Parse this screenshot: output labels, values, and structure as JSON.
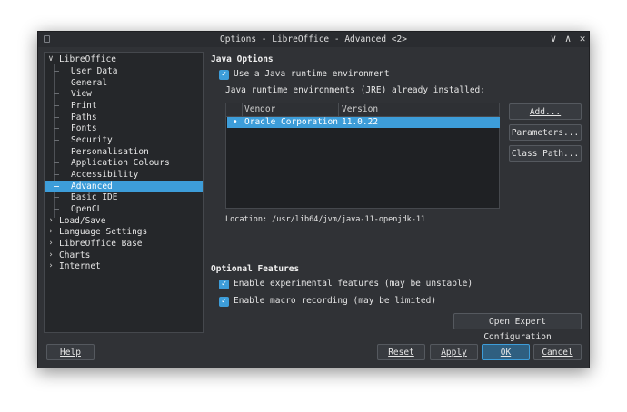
{
  "window": {
    "title": "Options - LibreOffice - Advanced <2>"
  },
  "titlebar_buttons": {
    "minimize": "∨",
    "maximize": "∧",
    "close": "✕"
  },
  "tree": {
    "items": [
      {
        "label": "LibreOffice",
        "level": 0,
        "expanded": true
      },
      {
        "label": "User Data",
        "level": 1
      },
      {
        "label": "General",
        "level": 1
      },
      {
        "label": "View",
        "level": 1
      },
      {
        "label": "Print",
        "level": 1
      },
      {
        "label": "Paths",
        "level": 1
      },
      {
        "label": "Fonts",
        "level": 1
      },
      {
        "label": "Security",
        "level": 1
      },
      {
        "label": "Personalisation",
        "level": 1
      },
      {
        "label": "Application Colours",
        "level": 1
      },
      {
        "label": "Accessibility",
        "level": 1
      },
      {
        "label": "Advanced",
        "level": 1,
        "selected": true
      },
      {
        "label": "Basic IDE",
        "level": 1
      },
      {
        "label": "OpenCL",
        "level": 1
      },
      {
        "label": "Load/Save",
        "level": 0,
        "expanded": false
      },
      {
        "label": "Language Settings",
        "level": 0,
        "expanded": false
      },
      {
        "label": "LibreOffice Base",
        "level": 0,
        "expanded": false
      },
      {
        "label": "Charts",
        "level": 0,
        "expanded": false
      },
      {
        "label": "Internet",
        "level": 0,
        "expanded": false
      }
    ]
  },
  "java": {
    "section_title": "Java Options",
    "use_jre_label": "Use a Java runtime environment",
    "use_jre_checked": true,
    "installed_label": "Java runtime environments (JRE) already installed:",
    "table": {
      "columns": [
        "Vendor",
        "Version"
      ],
      "rows": [
        {
          "bullet": "•",
          "vendor": "Oracle Corporation",
          "version": "11.0.22",
          "selected": true
        }
      ]
    },
    "location": "Location: /usr/lib64/jvm/java-11-openjdk-11",
    "buttons": {
      "add": "Add...",
      "parameters": "Parameters...",
      "class_path": "Class Path..."
    }
  },
  "optional": {
    "section_title": "Optional Features",
    "experimental_label": "Enable experimental features (may be unstable)",
    "experimental_checked": true,
    "macro_label": "Enable macro recording (may be limited)",
    "macro_checked": true,
    "expert_button": "Open Expert Configuration"
  },
  "footer": {
    "help": "Help",
    "reset": "Reset",
    "apply": "Apply",
    "ok": "OK",
    "cancel": "Cancel"
  },
  "colors": {
    "accent": "#3d9dd9",
    "window_bg": "#303236",
    "list_bg": "#25272a"
  }
}
